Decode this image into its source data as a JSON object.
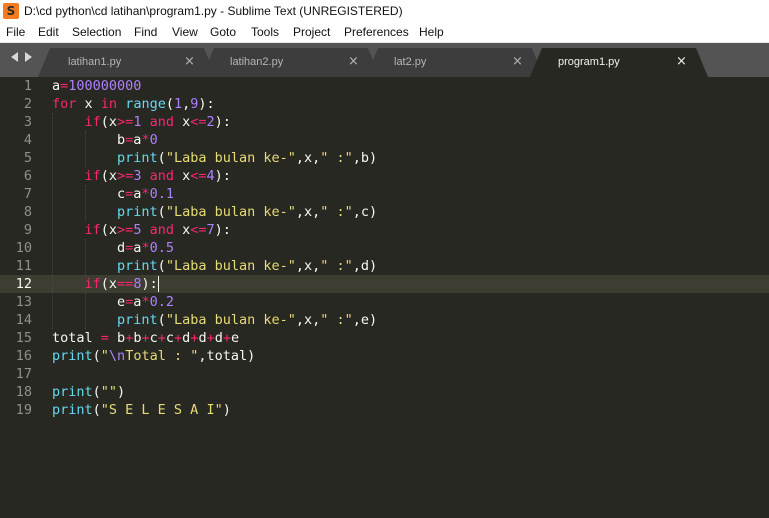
{
  "window": {
    "title": "D:\\cd python\\cd latihan\\program1.py - Sublime Text (UNREGISTERED)",
    "icon": "sublime-text-icon"
  },
  "menu": [
    "File",
    "Edit",
    "Selection",
    "Find",
    "View",
    "Goto",
    "Tools",
    "Project",
    "Preferences",
    "Help"
  ],
  "tabs": [
    {
      "label": "latihan1.py",
      "close": "×",
      "active": false
    },
    {
      "label": "latihan2.py",
      "close": "×",
      "active": false
    },
    {
      "label": "lat2.py",
      "close": "×",
      "active": false
    },
    {
      "label": "program1.py",
      "close": "×",
      "active": true
    }
  ],
  "editor": {
    "current_line": 12,
    "colors": {
      "background": "#272822",
      "keyword": "#f92672",
      "number": "#ae81ff",
      "string": "#e6db74",
      "builtin": "#66d9ef",
      "text": "#f8f8f2"
    },
    "lines": [
      [
        [
          "a",
          "t"
        ],
        [
          "=",
          "op"
        ],
        [
          "100000000",
          "num"
        ]
      ],
      [
        [
          "for",
          "kw"
        ],
        [
          " x ",
          "t"
        ],
        [
          "in",
          "kw"
        ],
        [
          " ",
          "t"
        ],
        [
          "range",
          "fn"
        ],
        [
          "(",
          "t"
        ],
        [
          "1",
          "num"
        ],
        [
          ",",
          "t"
        ],
        [
          "9",
          "num"
        ],
        [
          "):",
          "t"
        ]
      ],
      [
        [
          "    ",
          "t"
        ],
        [
          "if",
          "kw"
        ],
        [
          "(x",
          "t"
        ],
        [
          ">=",
          "op"
        ],
        [
          "1",
          "num"
        ],
        [
          " ",
          "t"
        ],
        [
          "and",
          "kw"
        ],
        [
          " x",
          "t"
        ],
        [
          "<=",
          "op"
        ],
        [
          "2",
          "num"
        ],
        [
          "):",
          "t"
        ]
      ],
      [
        [
          "        b",
          "t"
        ],
        [
          "=",
          "op"
        ],
        [
          "a",
          "t"
        ],
        [
          "*",
          "op"
        ],
        [
          "0",
          "num"
        ]
      ],
      [
        [
          "        ",
          "t"
        ],
        [
          "print",
          "fn"
        ],
        [
          "(",
          "t"
        ],
        [
          "\"Laba bulan ke-\"",
          "str"
        ],
        [
          ",x,",
          "t"
        ],
        [
          "\" :\"",
          "str"
        ],
        [
          ",b)",
          "t"
        ]
      ],
      [
        [
          "    ",
          "t"
        ],
        [
          "if",
          "kw"
        ],
        [
          "(x",
          "t"
        ],
        [
          ">=",
          "op"
        ],
        [
          "3",
          "num"
        ],
        [
          " ",
          "t"
        ],
        [
          "and",
          "kw"
        ],
        [
          " x",
          "t"
        ],
        [
          "<=",
          "op"
        ],
        [
          "4",
          "num"
        ],
        [
          "):",
          "t"
        ]
      ],
      [
        [
          "        c",
          "t"
        ],
        [
          "=",
          "op"
        ],
        [
          "a",
          "t"
        ],
        [
          "*",
          "op"
        ],
        [
          "0.1",
          "num"
        ]
      ],
      [
        [
          "        ",
          "t"
        ],
        [
          "print",
          "fn"
        ],
        [
          "(",
          "t"
        ],
        [
          "\"Laba bulan ke-\"",
          "str"
        ],
        [
          ",x,",
          "t"
        ],
        [
          "\" :\"",
          "str"
        ],
        [
          ",c)",
          "t"
        ]
      ],
      [
        [
          "    ",
          "t"
        ],
        [
          "if",
          "kw"
        ],
        [
          "(x",
          "t"
        ],
        [
          ">=",
          "op"
        ],
        [
          "5",
          "num"
        ],
        [
          " ",
          "t"
        ],
        [
          "and",
          "kw"
        ],
        [
          " x",
          "t"
        ],
        [
          "<=",
          "op"
        ],
        [
          "7",
          "num"
        ],
        [
          "):",
          "t"
        ]
      ],
      [
        [
          "        d",
          "t"
        ],
        [
          "=",
          "op"
        ],
        [
          "a",
          "t"
        ],
        [
          "*",
          "op"
        ],
        [
          "0.5",
          "num"
        ]
      ],
      [
        [
          "        ",
          "t"
        ],
        [
          "print",
          "fn"
        ],
        [
          "(",
          "t"
        ],
        [
          "\"Laba bulan ke-\"",
          "str"
        ],
        [
          ",x,",
          "t"
        ],
        [
          "\" :\"",
          "str"
        ],
        [
          ",d)",
          "t"
        ]
      ],
      [
        [
          "    ",
          "t"
        ],
        [
          "if",
          "kw"
        ],
        [
          "(x",
          "t"
        ],
        [
          "==",
          "op"
        ],
        [
          "8",
          "num"
        ],
        [
          "):",
          "t"
        ]
      ],
      [
        [
          "        e",
          "t"
        ],
        [
          "=",
          "op"
        ],
        [
          "a",
          "t"
        ],
        [
          "*",
          "op"
        ],
        [
          "0.2",
          "num"
        ]
      ],
      [
        [
          "        ",
          "t"
        ],
        [
          "print",
          "fn"
        ],
        [
          "(",
          "t"
        ],
        [
          "\"Laba bulan ke-\"",
          "str"
        ],
        [
          ",x,",
          "t"
        ],
        [
          "\" :\"",
          "str"
        ],
        [
          ",e)",
          "t"
        ]
      ],
      [
        [
          "total ",
          "t"
        ],
        [
          "=",
          "op"
        ],
        [
          " b",
          "t"
        ],
        [
          "+",
          "op"
        ],
        [
          "b",
          "t"
        ],
        [
          "+",
          "op"
        ],
        [
          "c",
          "t"
        ],
        [
          "+",
          "op"
        ],
        [
          "c",
          "t"
        ],
        [
          "+",
          "op"
        ],
        [
          "d",
          "t"
        ],
        [
          "+",
          "op"
        ],
        [
          "d",
          "t"
        ],
        [
          "+",
          "op"
        ],
        [
          "d",
          "t"
        ],
        [
          "+",
          "op"
        ],
        [
          "e",
          "t"
        ]
      ],
      [
        [
          "print",
          "fn"
        ],
        [
          "(",
          "t"
        ],
        [
          "\"",
          "str"
        ],
        [
          "\\n",
          "esc"
        ],
        [
          "Total : \"",
          "str"
        ],
        [
          ",total)",
          "t"
        ]
      ],
      [],
      [
        [
          "print",
          "fn"
        ],
        [
          "(",
          "t"
        ],
        [
          "\"\"",
          "str"
        ],
        [
          ")",
          "t"
        ]
      ],
      [
        [
          "print",
          "fn"
        ],
        [
          "(",
          "t"
        ],
        [
          "\"S E L E S A I\"",
          "str"
        ],
        [
          ")",
          "t"
        ]
      ]
    ]
  }
}
